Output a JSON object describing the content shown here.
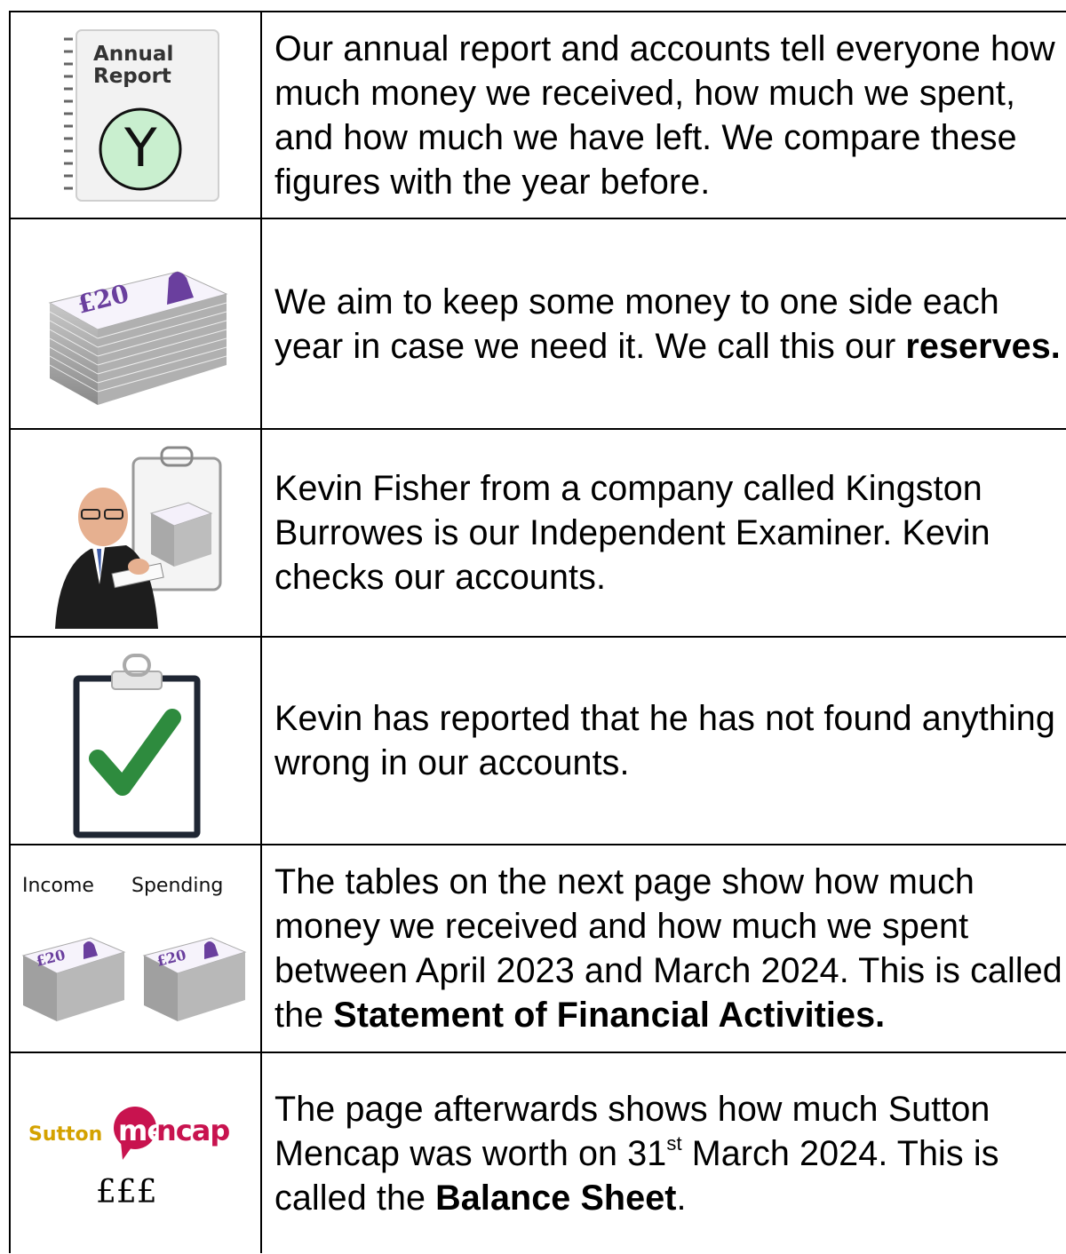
{
  "rows": [
    {
      "icon": "annual-report-icon",
      "annual_label_1": "Annual",
      "annual_label_2": "Report",
      "badge_letter": "Y",
      "text": "Our annual report and accounts tell everyone how much money we received, how much we spent, and how much we have left. We compare these figures with the year before."
    },
    {
      "icon": "banknote-stack-icon",
      "text": "We aim to keep some money to one side each year in case we need it.  We call this our ",
      "bold": "reserves."
    },
    {
      "icon": "examiner-person-icon",
      "text": "Kevin Fisher from a company called Kingston Burrowes is our Independent Examiner. Kevin checks our accounts."
    },
    {
      "icon": "clipboard-check-icon",
      "text": "Kevin has reported that he has not found anything wrong in our accounts."
    },
    {
      "icon": "income-spending-icon",
      "income_label": "Income",
      "spending_label": "Spending",
      "text": "The tables on the next page show how much money we received and how much we spent between April 2023 and March 2024. This is called the ",
      "bold": "Statement of Financial Activities."
    },
    {
      "icon": "sutton-mencap-logo",
      "logo_sutton": "Sutton",
      "logo_mencap": "mencap",
      "pounds": "£££",
      "text_a": "The page afterwards shows how much Sutton Mencap was worth on 31",
      "text_sup": "st",
      "text_b": " March 2024. This is called the ",
      "bold": "Balance Sheet",
      "text_end": "."
    }
  ],
  "colors": {
    "border": "#000000",
    "check_green": "#2e8b3e",
    "mencap_pink": "#c8134f",
    "sutton_gold": "#d4a200",
    "note_purple": "#6a3f9e"
  }
}
